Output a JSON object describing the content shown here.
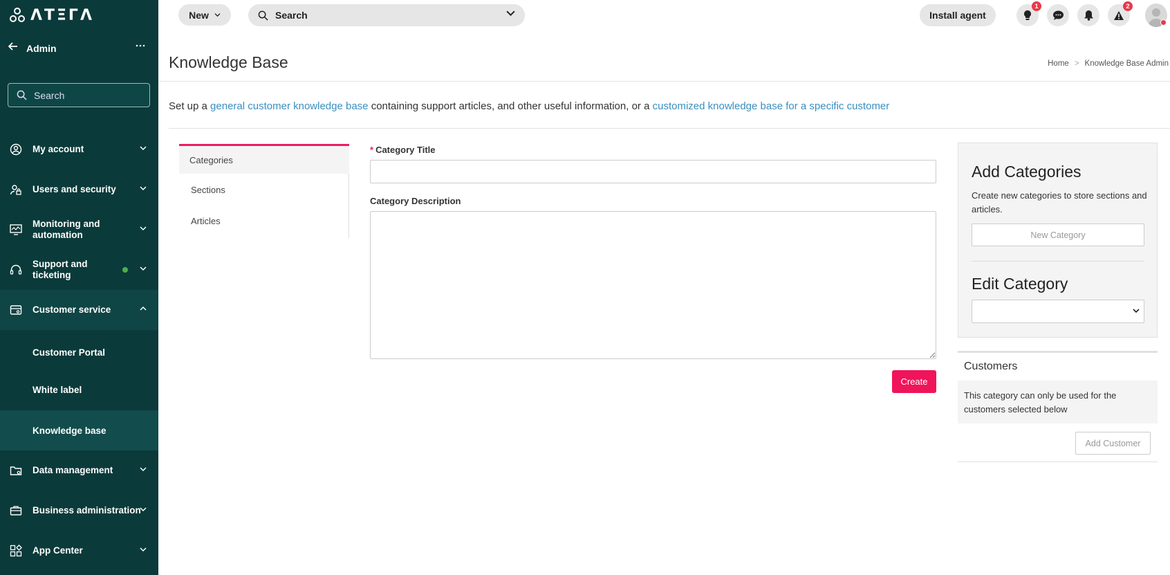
{
  "brand": {
    "logo_text": "ΛΤΞΓΛ"
  },
  "sidebar": {
    "admin_label": "Admin",
    "search_placeholder": "Search",
    "items": [
      {
        "label": "My account",
        "icon": "user-circle-icon"
      },
      {
        "label": "Users and security",
        "icon": "users-lock-icon"
      },
      {
        "label": "Monitoring and automation",
        "icon": "monitor-icon"
      },
      {
        "label": "Support and ticketing",
        "icon": "headset-icon"
      },
      {
        "label": "Customer service",
        "icon": "customer-service-icon"
      },
      {
        "label": "Data management",
        "icon": "folder-icon"
      },
      {
        "label": "Business administration",
        "icon": "briefcase-icon"
      },
      {
        "label": "App Center",
        "icon": "apps-icon"
      }
    ],
    "sub_items": [
      {
        "label": "Customer Portal"
      },
      {
        "label": "White label"
      },
      {
        "label": "Knowledge base"
      }
    ]
  },
  "topbar": {
    "new_label": "New",
    "search_label": "Search",
    "install_label": "Install agent",
    "badges": {
      "tips": "1",
      "alerts": "2"
    }
  },
  "page": {
    "title": "Knowledge Base",
    "breadcrumb": [
      "Home",
      "Knowledge Base Admin"
    ],
    "intro_prefix": "Set up a ",
    "intro_link1": "general customer knowledge base",
    "intro_middle": " containing support articles, and other useful information, or a ",
    "intro_link2": "customized knowledge base for a specific customer"
  },
  "tabs": [
    "Categories",
    "Sections",
    "Articles"
  ],
  "form": {
    "title_label": "Category Title",
    "title_value": "",
    "description_label": "Category Description",
    "description_value": "",
    "create_label": "Create"
  },
  "panel": {
    "add_title": "Add Categories",
    "add_desc": "Create new categories to store sections and articles.",
    "new_category_label": "New Category",
    "edit_title": "Edit Category",
    "edit_selected": ""
  },
  "customers": {
    "title": "Customers",
    "desc": "This category can only be used for the customers selected below",
    "add_label": "Add Customer"
  },
  "colors": {
    "sidebar_bg": "#0b3a3a",
    "accent": "#f0145a",
    "link": "#3a8fbf",
    "badge": "#e8394a"
  }
}
